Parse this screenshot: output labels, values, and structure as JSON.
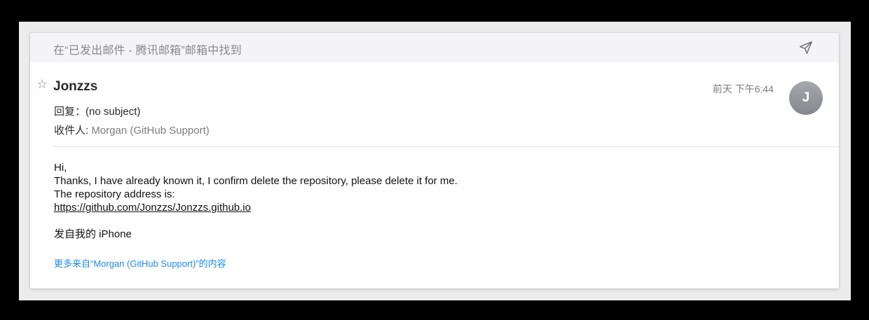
{
  "found_bar": {
    "text": "在“已发出邮件 - 腾讯邮箱”邮箱中找到",
    "send_icon": "paper-plane-icon"
  },
  "message": {
    "star_icon": "☆",
    "sender": "Jonzzs",
    "reply_label": "回复：",
    "reply_subject": "(no subject)",
    "to_label": "收件人:",
    "to_value": "Morgan (GitHub Support)",
    "timestamp": "前天 下午6:44",
    "avatar_initial": "J"
  },
  "body": {
    "greeting": "Hi,",
    "line1": "Thanks, I have already known it, I confirm delete the repository, please delete it for me.",
    "line2": "The repository address is:",
    "link": "https://github.com/Jonzzs/Jonzzs.github.io",
    "signature": "发自我的 iPhone"
  },
  "more_link": "更多来自“Morgan (GitHub Support)”的内容",
  "colors": {
    "accent": "#1c8ae8",
    "avatar": "#96979d",
    "found_bar_bg": "#f4f4f6"
  }
}
